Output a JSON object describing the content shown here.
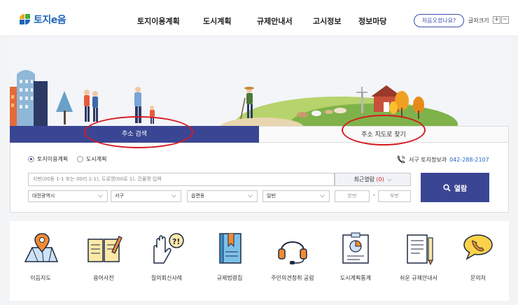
{
  "header": {
    "logo_text": "토지e음",
    "nav": [
      {
        "label": "토지이용계획"
      },
      {
        "label": "도시계획"
      },
      {
        "label": "규제안내서"
      },
      {
        "label": "고시정보"
      },
      {
        "label": "정보마당"
      }
    ],
    "first_visit_label": "처음오셨나요?",
    "font_size_label": "글자크기",
    "font_plus": "+",
    "font_minus": "−"
  },
  "tabs": {
    "address_search": "주소 검색",
    "map_search": "주소 지도로 찾기"
  },
  "search": {
    "radio_land": "토지이용계획",
    "radio_urban": "도시계획",
    "selected_radio": "토지이용계획",
    "contact_label": "서구 토지정보과",
    "contact_phone": "042-288-2107",
    "address_placeholder": "지번(00동 1-1 또는 00리 1-1), 도로명(00로 1), 건물명 입력",
    "recent_label": "최근열람",
    "recent_count": "(0)",
    "select_city": "대전광역시",
    "select_district": "서구",
    "select_town": "읍면동",
    "select_type": "일반",
    "main_number": "본번",
    "sub_number": "부번",
    "dash": "-",
    "search_button": "열람"
  },
  "quick_menu": [
    {
      "label": "이음지도",
      "icon": "map-pin-icon"
    },
    {
      "label": "용어사전",
      "icon": "book-icon"
    },
    {
      "label": "질의회신사례",
      "icon": "question-hand-icon"
    },
    {
      "label": "규제법령집",
      "icon": "law-book-icon"
    },
    {
      "label": "주민의견청취 공람",
      "icon": "headset-icon"
    },
    {
      "label": "도시계획통계",
      "icon": "chart-board-icon"
    },
    {
      "label": "쉬운 규제안내서",
      "icon": "document-pencil-icon"
    },
    {
      "label": "문의처",
      "icon": "phone-bubble-icon"
    }
  ],
  "colors": {
    "primary": "#3a4694",
    "accent_blue": "#2563c7",
    "highlight_red": "#d71920"
  }
}
